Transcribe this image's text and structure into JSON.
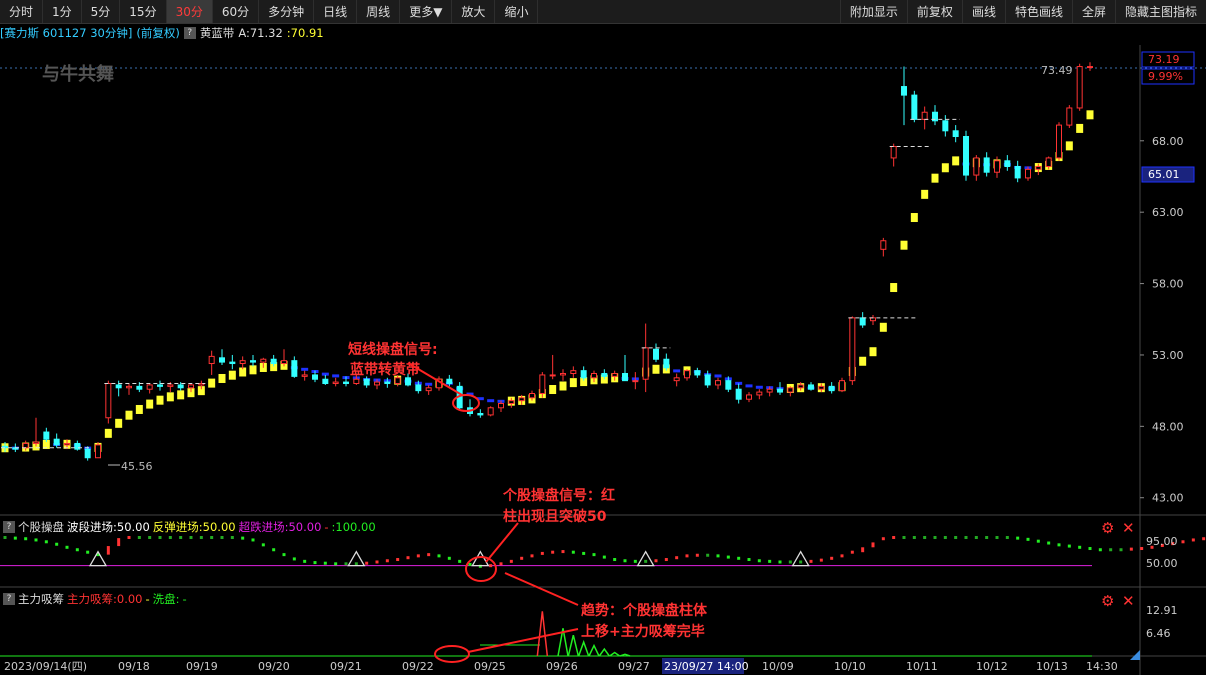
{
  "toolbar": {
    "left": [
      "分时",
      "1分",
      "5分",
      "15分",
      "30分",
      "60分",
      "多分钟",
      "日线",
      "周线",
      "更多▼",
      "放大",
      "缩小"
    ],
    "active": "30分",
    "right": [
      "附加显示",
      "前复权",
      "画线",
      "特色画线",
      "全屏",
      "隐藏主图指标"
    ]
  },
  "info": {
    "stock": "[赛力斯 601127 30分钟]",
    "adjust": "(前复权)",
    "indicator": "黄蓝带",
    "indicator_a": "A:71.32",
    "indicator_b": ":70.91"
  },
  "watermark": "与牛共舞",
  "main_axis": {
    "ticks": [
      "68.00",
      "63.00",
      "58.00",
      "53.00",
      "48.00",
      "43.00"
    ],
    "price_label": "73.19",
    "pct_label": "9.99%",
    "current_label": "65.01",
    "high_label": "73.49",
    "low_label": "45.56"
  },
  "panel1": {
    "name": "个股操盘",
    "l1": "波段进场:50.00",
    "l2": "反弹进场:50.00",
    "l3": "超跌进场:50.00",
    "l4": ":100.00",
    "dash": "-",
    "ticks": [
      "95.00",
      "50.00"
    ]
  },
  "panel2": {
    "name": "主力吸筹",
    "l1": "主力吸筹:0.00",
    "dash": "-",
    "l2": "洗盘:",
    "l3": "-",
    "ticks": [
      "12.91",
      "6.46"
    ]
  },
  "annotations": {
    "a1_line1": "短线操盘信号:",
    "a1_line2": "蓝带转黄带",
    "a2_line1": "个股操盘信号：红",
    "a2_line2": "柱出现且突破50",
    "a3_line1": "趋势：个股操盘柱体",
    "a3_line2": "上移+主力吸筹完毕"
  },
  "date_axis": [
    "2023/09/14(四)",
    "09/18",
    "09/19",
    "09/20",
    "09/21",
    "09/22",
    "09/25",
    "09/26",
    "09/27",
    "23/09/27 14:00",
    "10/09",
    "10/10",
    "10/11",
    "10/12",
    "10/13",
    "14:30"
  ],
  "colors": {
    "up": "#ff3333",
    "down": "#33ffff",
    "yellow": "#ffff33",
    "blue": "#1e32ff",
    "magenta": "#e020e0",
    "green": "#22ee22"
  },
  "chart_data": [
    {
      "type": "candlestick",
      "title": "赛力斯 601127 30分钟",
      "ylim": [
        42.0,
        74.5
      ],
      "y_ticks": [
        43,
        48,
        53,
        58,
        63,
        68
      ],
      "candles": [
        [
          46.6,
          46.9,
          46.2,
          46.5
        ],
        [
          46.5,
          46.8,
          46.2,
          46.4
        ],
        [
          46.5,
          47.0,
          46.3,
          46.8
        ],
        [
          46.8,
          48.6,
          46.6,
          46.9
        ],
        [
          47.6,
          47.9,
          46.9,
          47.1
        ],
        [
          47.1,
          47.5,
          46.5,
          46.7
        ],
        [
          46.7,
          47.1,
          46.4,
          46.8
        ],
        [
          46.8,
          47.0,
          46.3,
          46.4
        ],
        [
          46.4,
          46.6,
          45.6,
          45.8
        ],
        [
          45.8,
          46.9,
          45.8,
          46.7
        ],
        [
          48.6,
          51.2,
          48.2,
          51.0
        ],
        [
          50.9,
          51.2,
          50.1,
          50.7
        ],
        [
          50.7,
          51.0,
          50.2,
          50.8
        ],
        [
          50.8,
          51.1,
          50.4,
          50.6
        ],
        [
          50.6,
          51.0,
          50.3,
          50.9
        ],
        [
          50.9,
          51.2,
          50.5,
          50.8
        ],
        [
          50.8,
          51.1,
          50.4,
          50.9
        ],
        [
          50.9,
          51.1,
          50.5,
          50.7
        ],
        [
          50.7,
          51.0,
          50.4,
          50.9
        ],
        [
          50.9,
          51.2,
          50.6,
          51.0
        ],
        [
          52.4,
          53.3,
          51.6,
          52.9
        ],
        [
          52.8,
          53.4,
          52.3,
          52.5
        ],
        [
          52.5,
          53.0,
          52.0,
          52.4
        ],
        [
          52.4,
          52.9,
          52.0,
          52.6
        ],
        [
          52.6,
          53.0,
          52.2,
          52.5
        ],
        [
          52.5,
          52.8,
          52.1,
          52.7
        ],
        [
          52.7,
          53.0,
          52.2,
          52.4
        ],
        [
          52.4,
          53.4,
          52.2,
          52.6
        ],
        [
          52.6,
          52.9,
          51.4,
          51.5
        ],
        [
          51.5,
          51.9,
          51.2,
          51.6
        ],
        [
          51.6,
          51.9,
          51.1,
          51.3
        ],
        [
          51.3,
          51.6,
          50.9,
          51.0
        ],
        [
          51.0,
          51.4,
          50.8,
          51.1
        ],
        [
          51.1,
          51.5,
          50.8,
          51.0
        ],
        [
          51.0,
          51.7,
          50.9,
          51.3
        ],
        [
          51.3,
          51.5,
          50.7,
          50.9
        ],
        [
          50.9,
          51.3,
          50.6,
          51.1
        ],
        [
          51.1,
          51.4,
          50.7,
          51.0
        ],
        [
          51.0,
          51.6,
          50.8,
          51.4
        ],
        [
          51.4,
          51.7,
          50.8,
          50.9
        ],
        [
          50.9,
          51.2,
          50.3,
          50.5
        ],
        [
          50.5,
          50.9,
          50.2,
          50.7
        ],
        [
          50.7,
          51.5,
          50.5,
          51.3
        ],
        [
          51.3,
          51.6,
          50.8,
          51.0
        ],
        [
          50.8,
          51.1,
          49.1,
          49.3
        ],
        [
          49.3,
          49.9,
          48.7,
          48.9
        ],
        [
          48.9,
          49.2,
          48.6,
          48.8
        ],
        [
          48.8,
          49.4,
          48.7,
          49.3
        ],
        [
          49.3,
          49.8,
          49.0,
          49.6
        ],
        [
          49.6,
          50.0,
          49.3,
          49.8
        ],
        [
          49.8,
          50.2,
          49.5,
          50.0
        ],
        [
          50.0,
          50.5,
          49.8,
          50.3
        ],
        [
          50.3,
          51.8,
          50.0,
          51.6
        ],
        [
          51.6,
          53.0,
          51.3,
          51.6
        ],
        [
          51.6,
          52.0,
          51.2,
          51.7
        ],
        [
          51.7,
          52.2,
          51.4,
          51.9
        ],
        [
          51.9,
          52.2,
          51.2,
          51.4
        ],
        [
          51.4,
          51.9,
          51.1,
          51.7
        ],
        [
          51.7,
          52.0,
          51.3,
          51.5
        ],
        [
          51.5,
          51.9,
          51.2,
          51.7
        ],
        [
          51.7,
          53.0,
          51.2,
          51.2
        ],
        [
          51.2,
          51.8,
          50.6,
          51.2
        ],
        [
          51.3,
          55.2,
          50.4,
          53.5
        ],
        [
          53.4,
          53.8,
          52.5,
          52.7
        ],
        [
          52.7,
          53.1,
          51.9,
          52.1
        ],
        [
          51.2,
          51.7,
          50.8,
          51.4
        ],
        [
          51.4,
          52.0,
          51.2,
          51.9
        ],
        [
          51.9,
          52.1,
          51.4,
          51.6
        ],
        [
          51.6,
          51.9,
          50.7,
          50.9
        ],
        [
          50.9,
          51.4,
          50.6,
          51.2
        ],
        [
          51.2,
          51.5,
          50.4,
          50.6
        ],
        [
          50.6,
          51.0,
          49.6,
          49.9
        ],
        [
          49.9,
          50.4,
          49.7,
          50.2
        ],
        [
          50.2,
          50.6,
          49.9,
          50.4
        ],
        [
          50.4,
          50.8,
          50.1,
          50.6
        ],
        [
          50.6,
          51.1,
          50.2,
          50.4
        ],
        [
          50.4,
          50.8,
          50.1,
          50.7
        ],
        [
          50.7,
          51.1,
          50.5,
          50.9
        ],
        [
          50.9,
          51.1,
          50.5,
          50.6
        ],
        [
          50.6,
          51.0,
          50.4,
          50.8
        ],
        [
          50.8,
          51.1,
          50.3,
          50.5
        ],
        [
          50.5,
          51.4,
          50.4,
          51.2
        ],
        [
          51.2,
          55.7,
          50.9,
          55.6
        ],
        [
          55.6,
          56.0,
          54.9,
          55.1
        ],
        [
          55.4,
          55.8,
          55.1,
          55.6
        ],
        [
          60.4,
          61.2,
          59.9,
          61.0
        ],
        [
          66.8,
          67.8,
          66.2,
          67.6
        ],
        [
          71.8,
          73.2,
          69.1,
          71.2
        ],
        [
          71.2,
          71.5,
          69.3,
          69.5
        ],
        [
          69.5,
          70.4,
          68.8,
          70.0
        ],
        [
          70.0,
          70.5,
          69.1,
          69.4
        ],
        [
          69.4,
          69.8,
          68.3,
          68.7
        ],
        [
          68.7,
          69.1,
          67.9,
          68.3
        ],
        [
          68.3,
          68.7,
          65.2,
          65.6
        ],
        [
          65.6,
          67.0,
          65.2,
          66.8
        ],
        [
          66.8,
          67.2,
          65.5,
          65.8
        ],
        [
          65.8,
          66.9,
          65.4,
          66.6
        ],
        [
          66.6,
          67.0,
          65.9,
          66.2
        ],
        [
          66.2,
          66.6,
          65.1,
          65.4
        ],
        [
          65.4,
          66.2,
          65.2,
          66.0
        ],
        [
          66.0,
          66.4,
          65.6,
          66.2
        ],
        [
          66.2,
          66.9,
          66.0,
          66.8
        ],
        [
          66.8,
          69.3,
          66.6,
          69.1
        ],
        [
          69.1,
          70.5,
          68.9,
          70.3
        ],
        [
          70.3,
          73.4,
          70.1,
          73.2
        ],
        [
          73.2,
          73.5,
          72.9,
          73.2
        ]
      ]
    },
    {
      "type": "line",
      "title": "个股操盘",
      "ylim": [
        20,
        105
      ],
      "reference_line": 50,
      "values": [
        96,
        95,
        94,
        92,
        89,
        85,
        80,
        76,
        72,
        68,
        82,
        95,
        96,
        96,
        96,
        96,
        96,
        96,
        96,
        96,
        96,
        96,
        96,
        95,
        92,
        84,
        76,
        68,
        61,
        57,
        55,
        54,
        53,
        53,
        53,
        54,
        56,
        58,
        60,
        63,
        66,
        68,
        66,
        62,
        57,
        52,
        49,
        50,
        53,
        57,
        62,
        66,
        70,
        72,
        73,
        72,
        70,
        68,
        64,
        60,
        58,
        57,
        57,
        58,
        60,
        63,
        66,
        67,
        67,
        66,
        64,
        62,
        60,
        58,
        57,
        56,
        56,
        56,
        57,
        59,
        62,
        66,
        72,
        80,
        88,
        94,
        96,
        96,
        96,
        96,
        96,
        96,
        96,
        96,
        96,
        96,
        96,
        96,
        95,
        93,
        90,
        87,
        84,
        82,
        80,
        78,
        76,
        76,
        76,
        77,
        78,
        80,
        83,
        86,
        89,
        92,
        94,
        96,
        96,
        96,
        96
      ]
    },
    {
      "type": "line",
      "title": "主力吸筹",
      "ylim": [
        0,
        15
      ],
      "series": [
        {
          "name": "主力吸筹",
          "values": [
            0,
            0,
            0,
            0,
            0,
            0,
            0,
            0,
            0,
            0,
            0,
            0,
            0,
            0,
            0,
            0,
            0,
            0,
            0,
            0,
            0,
            0,
            0,
            0,
            0,
            0,
            0,
            0,
            0,
            0,
            0,
            0,
            0,
            0,
            0,
            0,
            0,
            0,
            0,
            0,
            0,
            0,
            0,
            0,
            0,
            0,
            0,
            0,
            0,
            0,
            0,
            0,
            12.9,
            0,
            0,
            0,
            0,
            0,
            0,
            0,
            0,
            0,
            0,
            0,
            0,
            0,
            0,
            0,
            0,
            0,
            0,
            0,
            0,
            0,
            0,
            0,
            0,
            0,
            0,
            0,
            0,
            0,
            0,
            0,
            0,
            0,
            0,
            0,
            0,
            0,
            0,
            0,
            0,
            0,
            0,
            0,
            0,
            0,
            0,
            0,
            0,
            0,
            0,
            0,
            0,
            0,
            0,
            0,
            0,
            0,
            0,
            0,
            0,
            0,
            0,
            0,
            0,
            0,
            0,
            0
          ]
        },
        {
          "name": "洗盘",
          "values": [
            0,
            0,
            0,
            0,
            0,
            0,
            0,
            0,
            0,
            0,
            0,
            0,
            0,
            0,
            0,
            0,
            0,
            0,
            0,
            0,
            0,
            0,
            0,
            0,
            0,
            0,
            0,
            0,
            0,
            0,
            0,
            0,
            0,
            0,
            0,
            0,
            0,
            0,
            0,
            0,
            0,
            0,
            0,
            0,
            0,
            0,
            0,
            0,
            0,
            0,
            0,
            0,
            0,
            0,
            8.0,
            6.0,
            4.0,
            3.0,
            2.0,
            1.0,
            0.5,
            0,
            0,
            0,
            0,
            0,
            0,
            0,
            0,
            0,
            0,
            0,
            0,
            0,
            0,
            0,
            0,
            0,
            0,
            0,
            0,
            0,
            0,
            0,
            0,
            0,
            0,
            0,
            0,
            0,
            0,
            0,
            0,
            0,
            0,
            0,
            0,
            0,
            0,
            0,
            0,
            0,
            0,
            0,
            0,
            0,
            0,
            0,
            0,
            0,
            0,
            0,
            0,
            0,
            0,
            0,
            0,
            0
          ]
        }
      ]
    }
  ]
}
